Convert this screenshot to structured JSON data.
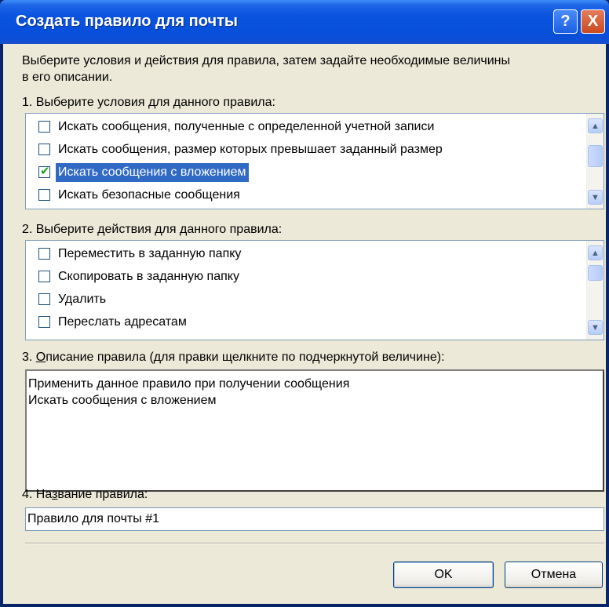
{
  "window": {
    "title": "Создать правило для почты",
    "help_glyph": "?",
    "close_glyph": "X"
  },
  "intro": {
    "line1": "Выберите условия и действия для правила, затем задайте необходимые величины",
    "line2": "в его описании."
  },
  "conditions": {
    "label": "1. Выберите условия для данного правила:",
    "items": [
      {
        "label": "Искать сообщения, полученные с определенной учетной записи",
        "checked": false,
        "selected": false
      },
      {
        "label": "Искать сообщения, размер которых превышает заданный размер",
        "checked": false,
        "selected": false
      },
      {
        "label": "Искать сообщения с вложением",
        "checked": true,
        "selected": true
      },
      {
        "label": "Искать безопасные сообщения",
        "checked": false,
        "selected": false
      }
    ]
  },
  "actions": {
    "label": "2. Выберите действия для данного правила:",
    "items": [
      {
        "label": "Переместить в заданную папку",
        "checked": false
      },
      {
        "label": "Скопировать в заданную папку",
        "checked": false
      },
      {
        "label": "Удалить",
        "checked": false
      },
      {
        "label": "Переслать адресатам",
        "checked": false
      }
    ]
  },
  "description": {
    "label_prefix": "3. ",
    "label_underlined": "О",
    "label_rest": "писание правила (для правки щелкните по подчеркнутой величине):",
    "lines": [
      "Применить данное правило при получении сообщения",
      "Искать сообщения с вложением"
    ]
  },
  "rule_name": {
    "label_prefix": "4. На",
    "label_underlined": "з",
    "label_rest": "вание правила:",
    "value": "Правило для почты #1"
  },
  "buttons": {
    "ok": "OK",
    "cancel": "Отмена"
  },
  "colors": {
    "titlebar": "#0a54e0",
    "face": "#ece9d8",
    "selection": "#316ac5",
    "check": "#21a121"
  }
}
